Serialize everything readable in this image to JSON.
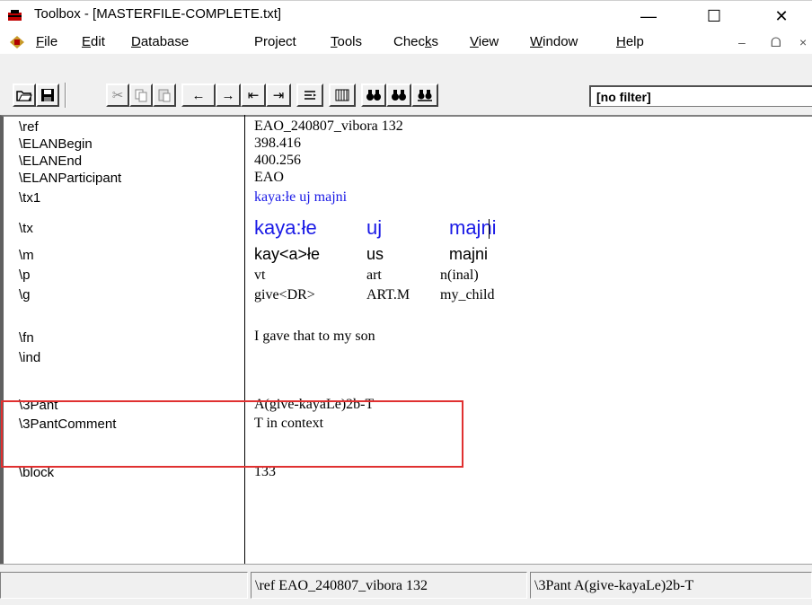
{
  "window": {
    "title": "Toolbox - [MASTERFILE-COMPLETE.txt]",
    "controls": {
      "minimize": "—",
      "maximize": "☐",
      "close": "✕"
    }
  },
  "menu": {
    "items": [
      {
        "label": "File",
        "underline": "F"
      },
      {
        "label": "Edit",
        "underline": "E"
      },
      {
        "label": "Database",
        "underline": "D"
      },
      {
        "label": "Project",
        "underline": "j"
      },
      {
        "label": "Tools",
        "underline": "T"
      },
      {
        "label": "Checks",
        "underline": "k"
      },
      {
        "label": "View",
        "underline": "V"
      },
      {
        "label": "Window",
        "underline": "W"
      },
      {
        "label": "Help",
        "underline": "H"
      }
    ],
    "mdi_controls": {
      "minimize": "–",
      "restore": "ᗝ",
      "close": "×"
    }
  },
  "toolbar": {
    "buttons": [
      "open-folder",
      "save",
      "cut",
      "copy",
      "paste",
      "previous",
      "next",
      "first",
      "last",
      "interlinear",
      "browse",
      "find",
      "find-next",
      "find-previous"
    ],
    "glyphs": {
      "previous": "←",
      "next": "→",
      "first": "⇤",
      "last": "⇥"
    },
    "filter_label": "[no filter]"
  },
  "record": {
    "fields": [
      {
        "marker": "\\ref",
        "value": "EAO_240807_vibora 132"
      },
      {
        "marker": "\\ELANBegin",
        "value": "398.416"
      },
      {
        "marker": "\\ELANEnd",
        "value": "400.256"
      },
      {
        "marker": "\\ELANParticipant",
        "value": "EAO"
      },
      {
        "marker": "\\tx1",
        "value": "kaya:łe uj majni"
      },
      {
        "marker": "\\tx",
        "value": [
          "kaya:łe",
          "uj",
          "majni"
        ]
      },
      {
        "marker": "\\m",
        "value": [
          "kay<a>łe",
          "us",
          "majni"
        ]
      },
      {
        "marker": "\\p",
        "value": [
          "vt",
          "art",
          "n(inal)"
        ]
      },
      {
        "marker": "\\g",
        "value": [
          "give<DR>",
          "ART.M",
          "my_child"
        ]
      },
      {
        "marker": "\\fn",
        "value": "I gave that to my son"
      },
      {
        "marker": "\\ind",
        "value": ""
      },
      {
        "marker": "\\3Pant",
        "value": "A(give-kayaLe)2b-T"
      },
      {
        "marker": "\\3PantComment",
        "value": "T in context"
      },
      {
        "marker": "\\block",
        "value": "133"
      }
    ]
  },
  "status": {
    "panels": [
      "\\ref EAO_240807_vibora 132",
      "\\3Pant A(give-kayaLe)2b-T"
    ]
  },
  "colors": {
    "highlight_box": "#e03030",
    "interlinear_text": "#1a1ae6"
  }
}
